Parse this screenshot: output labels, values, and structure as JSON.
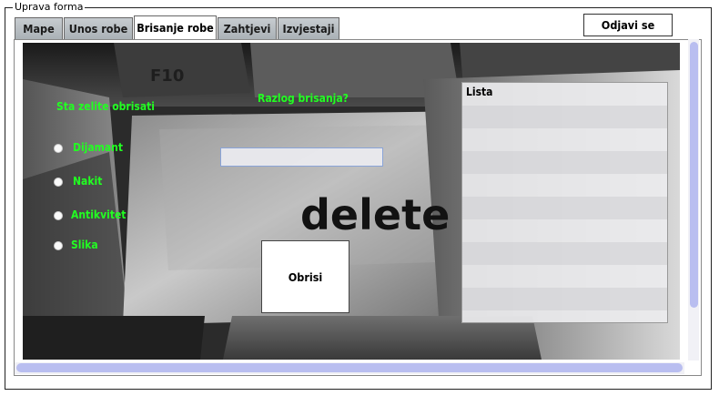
{
  "window": {
    "group_title": "Uprava forma"
  },
  "tabs": [
    {
      "label": "Mape"
    },
    {
      "label": "Unos robe"
    },
    {
      "label": "Brisanje robe"
    },
    {
      "label": "Zahtjevi"
    },
    {
      "label": "Izvjestaji"
    }
  ],
  "active_tab": "Brisanje robe",
  "header": {
    "logout_label": "Odjavi se"
  },
  "form": {
    "question_label": "Sta zelite obrisati",
    "reason_label": "Razlog brisanja?",
    "reason_value": "",
    "options": [
      {
        "label": "Dijamant",
        "checked": false
      },
      {
        "label": "Nakit",
        "checked": false
      },
      {
        "label": "Antikvitet",
        "checked": false
      },
      {
        "label": "Slika",
        "checked": false
      }
    ],
    "delete_button_label": "Obrisi",
    "list_header": "Lista",
    "background_key_text": "delete"
  },
  "colors": {
    "label_green": "#22ff22",
    "scrollbar_thumb": "#b9bef0",
    "tab_inactive": "#b8bec2"
  }
}
